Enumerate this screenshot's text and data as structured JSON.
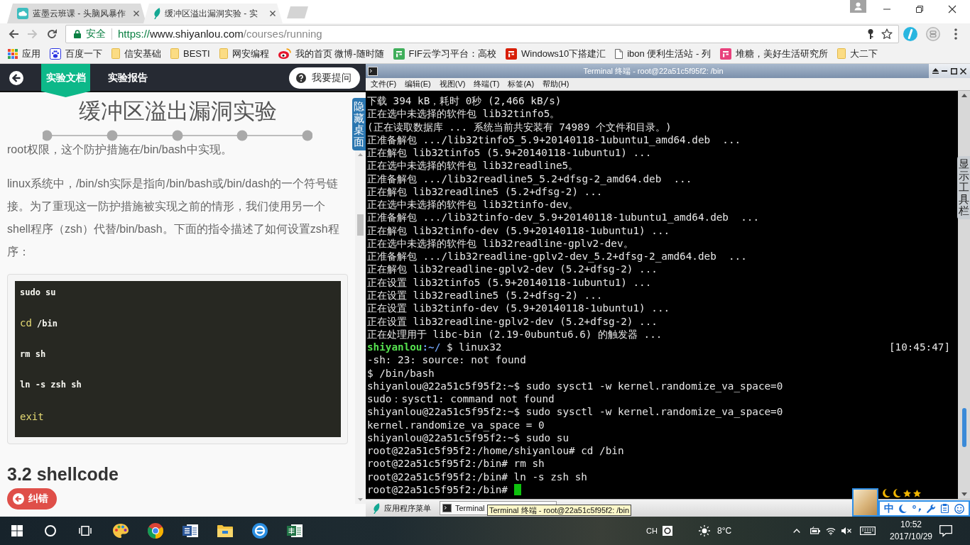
{
  "browser": {
    "tabs": [
      {
        "title": "蓝墨云班课 - 头脑风暴作",
        "kind": "cloud",
        "selected": false
      },
      {
        "title": "缓冲区溢出漏洞实验 - 实",
        "kind": "leaf",
        "selected": true
      }
    ],
    "nav_buttons": [
      {
        "kind": "back",
        "disabled": false
      },
      {
        "kind": "forward",
        "disabled": true
      },
      {
        "kind": "reload",
        "disabled": false
      }
    ],
    "address_bar": {
      "security_label": "安全",
      "scheme": "https://",
      "host": "www.shiyanlou.com",
      "path": "/courses/running"
    },
    "bookmarks": [
      {
        "label": "应用",
        "kind": "apps"
      },
      {
        "label": "百度一下",
        "kind": "paw"
      },
      {
        "label": "信安基础",
        "kind": "folder"
      },
      {
        "label": "BESTI",
        "kind": "folder"
      },
      {
        "label": "网安编程",
        "kind": "folder"
      },
      {
        "label": "我的首页 微博-随时随",
        "kind": "eye"
      },
      {
        "label": "FIF云学习平台：高校",
        "kind": "badge",
        "color": "#3fae5a"
      },
      {
        "label": "Windows10下搭建汇",
        "kind": "badge",
        "color": "#d81e06"
      },
      {
        "label": "ibon 便利生活站 - 列",
        "kind": "page"
      },
      {
        "label": "堆糖，美好生活研究所",
        "kind": "badge",
        "color": "#e8417c"
      },
      {
        "label": "大二下",
        "kind": "folder"
      }
    ]
  },
  "lesson": {
    "nav_tabs": [
      {
        "label": "实验文档",
        "selected": true
      },
      {
        "label": "实验报告",
        "selected": false
      }
    ],
    "ask_button": "我要提问",
    "title": "缓冲区溢出漏洞实验",
    "paragraphs": [
      "root权限，这个防护措施在/bin/bash中实现。",
      "linux系统中，/bin/sh实际是指向/bin/bash或/bin/dash的一个符号链接。为了重现这一防护措施被实现之前的情形，我们使用另一个shell程序（zsh）代替/bin/bash。下面的指令描述了如何设置zsh程序："
    ],
    "code_lines": [
      [
        {
          "kind": "plain",
          "text": "sudo su"
        }
      ],
      [
        {
          "kind": "keyword",
          "text": "cd"
        },
        {
          "kind": "plain",
          "text": "/bin"
        }
      ],
      [
        {
          "kind": "plain",
          "text": "rm sh"
        }
      ],
      [
        {
          "kind": "plain",
          "text": "ln -s zsh sh"
        }
      ],
      [
        {
          "kind": "keyword",
          "text": "exit"
        }
      ]
    ],
    "heading": "3.2 shellcode",
    "side_tab": "隐藏桌面",
    "feedback_button": "纠错"
  },
  "terminal": {
    "title": "Terminal 终端 - root@22a51c5f95f2: /bin",
    "menu": [
      "文件(F)",
      "编辑(E)",
      "视图(V)",
      "终端(T)",
      "标签(A)",
      "帮助(H)"
    ],
    "lines": [
      {
        "kind": "output",
        "text": "下载 394 kB，耗时 0秒 (2,466 kB/s)"
      },
      {
        "kind": "output",
        "text": "正在选中未选择的软件包 lib32tinfo5。"
      },
      {
        "kind": "output",
        "text": "(正在读取数据库 ... 系统当前共安装有 74989 个文件和目录。)"
      },
      {
        "kind": "output",
        "text": "正准备解包 .../lib32tinfo5_5.9+20140118-1ubuntu1_amd64.deb  ..."
      },
      {
        "kind": "output",
        "text": "正在解包 lib32tinfo5 (5.9+20140118-1ubuntu1) ..."
      },
      {
        "kind": "output",
        "text": "正在选中未选择的软件包 lib32readline5。"
      },
      {
        "kind": "output",
        "text": "正准备解包 .../lib32readline5_5.2+dfsg-2_amd64.deb  ..."
      },
      {
        "kind": "output",
        "text": "正在解包 lib32readline5 (5.2+dfsg-2) ..."
      },
      {
        "kind": "output",
        "text": "正在选中未选择的软件包 lib32tinfo-dev。"
      },
      {
        "kind": "output",
        "text": "正准备解包 .../lib32tinfo-dev_5.9+20140118-1ubuntu1_amd64.deb  ..."
      },
      {
        "kind": "output",
        "text": "正在解包 lib32tinfo-dev (5.9+20140118-1ubuntu1) ..."
      },
      {
        "kind": "output",
        "text": "正在选中未选择的软件包 lib32readline-gplv2-dev。"
      },
      {
        "kind": "output",
        "text": "正准备解包 .../lib32readline-gplv2-dev_5.2+dfsg-2_amd64.deb  ..."
      },
      {
        "kind": "output",
        "text": "正在解包 lib32readline-gplv2-dev (5.2+dfsg-2) ..."
      },
      {
        "kind": "output",
        "text": "正在设置 lib32tinfo5 (5.9+20140118-1ubuntu1) ..."
      },
      {
        "kind": "output",
        "text": "正在设置 lib32readline5 (5.2+dfsg-2) ..."
      },
      {
        "kind": "output",
        "text": "正在设置 lib32tinfo-dev (5.9+20140118-1ubuntu1) ..."
      },
      {
        "kind": "output",
        "text": "正在设置 lib32readline-gplv2-dev (5.2+dfsg-2) ..."
      },
      {
        "kind": "output",
        "text": "正在处理用于 libc-bin (2.19-0ubuntu6.6) 的触发器 ..."
      },
      {
        "kind": "prompt",
        "user": "shiyanlou",
        "location": ":~/",
        "command": "$ linux32",
        "time": "[10:45:47]"
      },
      {
        "kind": "output",
        "text": "-sh: 23: source: not found"
      },
      {
        "kind": "output",
        "text": "$ /bin/bash"
      },
      {
        "kind": "output",
        "text": "shiyanlou@22a51c5f95f2:~$ sudo sysct1 -w kernel.randomize_va_space=0"
      },
      {
        "kind": "output",
        "text": "sudo：sysct1: command not found"
      },
      {
        "kind": "output",
        "text": "shiyanlou@22a51c5f95f2:~$ sudo sysctl -w kernel.randomize_va_space=0"
      },
      {
        "kind": "output",
        "text": "kernel.randomize_va_space = 0"
      },
      {
        "kind": "output",
        "text": "shiyanlou@22a51c5f95f2:~$ sudo su"
      },
      {
        "kind": "output",
        "text": "root@22a51c5f95f2:/home/shiyanlou# cd /bin"
      },
      {
        "kind": "output",
        "text": "root@22a51c5f95f2:/bin# rm sh"
      },
      {
        "kind": "output",
        "text": "root@22a51c5f95f2:/bin# ln -s zsh sh"
      },
      {
        "kind": "output",
        "text": "root@22a51c5f95f2:/bin#"
      }
    ],
    "cursor": true,
    "side_tab": "显示工具栏"
  },
  "vnc_panel": {
    "menu_button": "应用程序菜单",
    "task_button": "Terminal",
    "tooltip": "Terminal 终端 - root@22a51c5f95f2: /bin",
    "ime_mode": "中"
  },
  "taskbar": {
    "input_language": "CH",
    "temperature": "8°C",
    "time": "10:52",
    "date": "2017/10/29"
  }
}
